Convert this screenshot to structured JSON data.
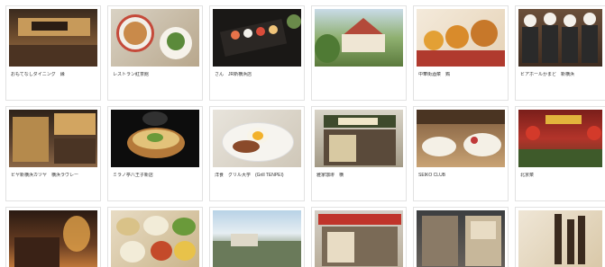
{
  "colors": {
    "tag_orange": "#e8742a",
    "tag_blue": "#3b8fc8",
    "title_green": "#6aa324"
  },
  "cards": [
    {
      "title": "おもてなしダイニング　縁",
      "tag": "",
      "desc": "",
      "title_green": false,
      "tag_color": "orange"
    },
    {
      "title": "レストラン紅茶館",
      "tag": "",
      "desc": "",
      "title_green": false,
      "tag_color": "orange"
    },
    {
      "title": "さん　JR新横浜店",
      "tag": "",
      "desc": "",
      "title_green": false,
      "tag_color": "blue"
    },
    {
      "title": "",
      "tag": "",
      "desc": "",
      "title_green": true,
      "tag_color": "blue"
    },
    {
      "title": "中華街酒菜　鶏",
      "tag": "",
      "desc": "",
      "title_green": false,
      "tag_color": "orange"
    },
    {
      "title": "ビアホールかまど　新横浜",
      "tag": "",
      "desc": "",
      "title_green": false,
      "tag_color": "blue"
    },
    {
      "title": "ビヤ新横浜カツヤ　横浜ラヴレー",
      "tag": "",
      "desc": "",
      "title_green": false,
      "tag_color": "orange"
    },
    {
      "title": "ミラノ亭八王子新店",
      "tag": "",
      "desc": "",
      "title_green": false,
      "tag_color": "blue"
    },
    {
      "title": "洋食　グリル大学　(Grill TENPEI)",
      "tag": "",
      "desc": "",
      "title_green": false,
      "tag_color": "orange"
    },
    {
      "title": "雅家珈琲　横",
      "tag": "",
      "desc": "",
      "title_green": false,
      "tag_color": "blue"
    },
    {
      "title": "SEIKO CLUB",
      "tag": "",
      "desc": "",
      "title_green": false,
      "tag_color": "orange"
    },
    {
      "title": "北京菜",
      "tag": "",
      "desc": "",
      "title_green": false,
      "tag_color": "blue"
    },
    {
      "title": "",
      "tag": "",
      "desc": "",
      "title_green": false,
      "tag_color": "orange"
    },
    {
      "title": "",
      "tag": "",
      "desc": "",
      "title_green": false,
      "tag_color": "blue"
    },
    {
      "title": "",
      "tag": "",
      "desc": "",
      "title_green": false,
      "tag_color": "orange"
    },
    {
      "title": "",
      "tag": "",
      "desc": "",
      "title_green": false,
      "tag_color": "blue"
    },
    {
      "title": "",
      "tag": "",
      "desc": "",
      "title_green": false,
      "tag_color": "blue"
    },
    {
      "title": "",
      "tag": "",
      "desc": "",
      "title_green": false,
      "tag_color": "blue"
    }
  ]
}
